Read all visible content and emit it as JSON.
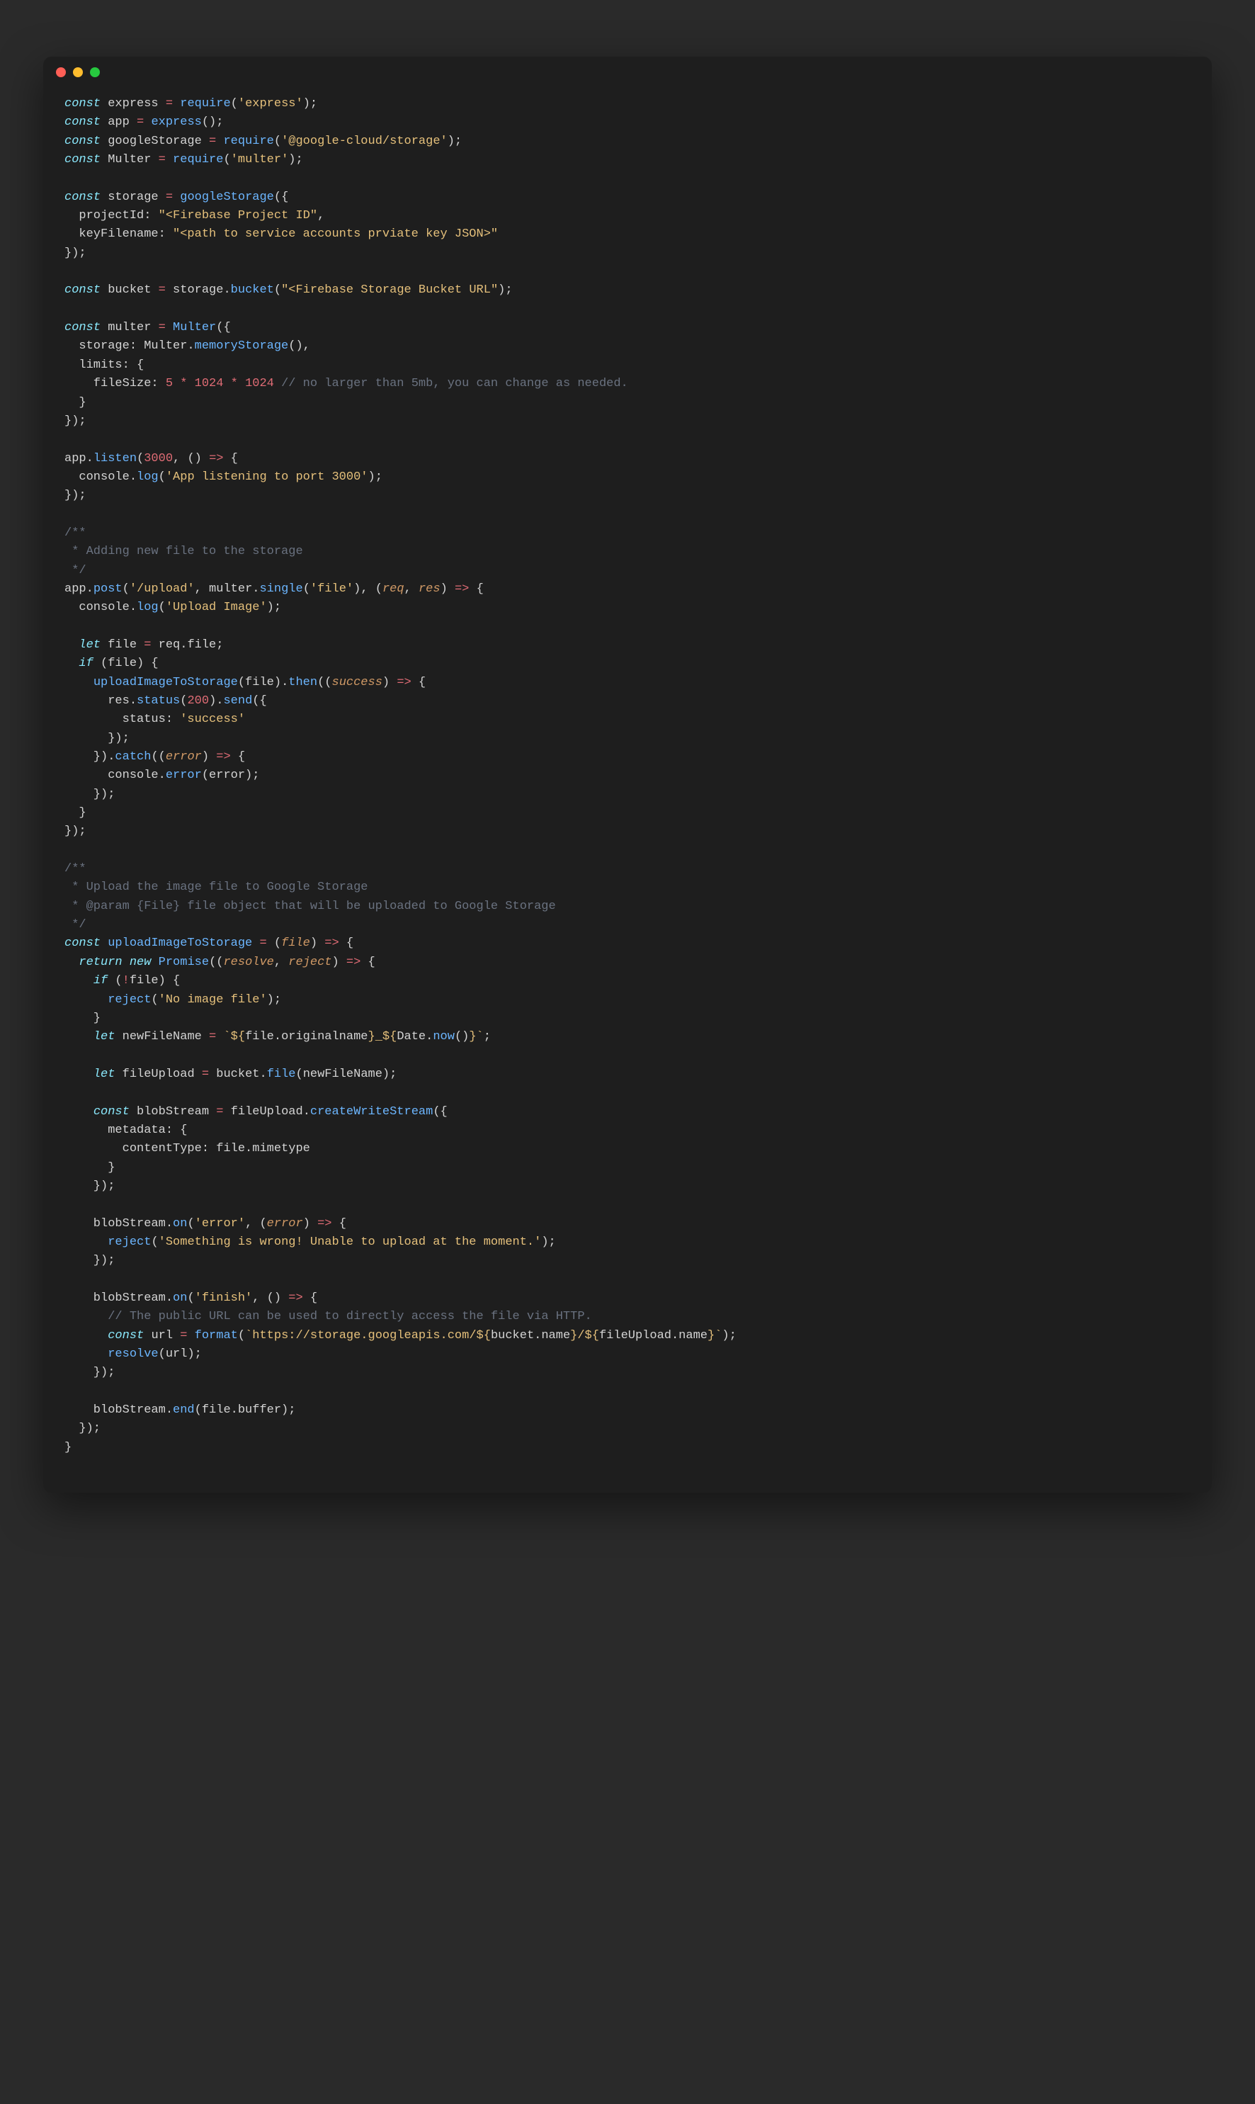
{
  "window": {
    "dots": [
      "red",
      "yellow",
      "green"
    ]
  },
  "code": {
    "lines": [
      [
        {
          "t": "const ",
          "c": "kw"
        },
        {
          "t": "express",
          "c": "def"
        },
        {
          "t": " = ",
          "c": "op"
        },
        {
          "t": "require",
          "c": "call"
        },
        {
          "t": "(",
          "c": "punc"
        },
        {
          "t": "'express'",
          "c": "str"
        },
        {
          "t": ");",
          "c": "punc"
        }
      ],
      [
        {
          "t": "const ",
          "c": "kw"
        },
        {
          "t": "app",
          "c": "def"
        },
        {
          "t": " = ",
          "c": "op"
        },
        {
          "t": "express",
          "c": "call"
        },
        {
          "t": "();",
          "c": "punc"
        }
      ],
      [
        {
          "t": "const ",
          "c": "kw"
        },
        {
          "t": "googleStorage",
          "c": "def"
        },
        {
          "t": " = ",
          "c": "op"
        },
        {
          "t": "require",
          "c": "call"
        },
        {
          "t": "(",
          "c": "punc"
        },
        {
          "t": "'@google-cloud/storage'",
          "c": "str"
        },
        {
          "t": ");",
          "c": "punc"
        }
      ],
      [
        {
          "t": "const ",
          "c": "kw"
        },
        {
          "t": "Multer",
          "c": "def"
        },
        {
          "t": " = ",
          "c": "op"
        },
        {
          "t": "require",
          "c": "call"
        },
        {
          "t": "(",
          "c": "punc"
        },
        {
          "t": "'multer'",
          "c": "str"
        },
        {
          "t": ");",
          "c": "punc"
        }
      ],
      [],
      [
        {
          "t": "const ",
          "c": "kw"
        },
        {
          "t": "storage",
          "c": "def"
        },
        {
          "t": " = ",
          "c": "op"
        },
        {
          "t": "googleStorage",
          "c": "call"
        },
        {
          "t": "({",
          "c": "punc"
        }
      ],
      [
        {
          "t": "  projectId: ",
          "c": "prop"
        },
        {
          "t": "\"<Firebase Project ID\"",
          "c": "str"
        },
        {
          "t": ",",
          "c": "punc"
        }
      ],
      [
        {
          "t": "  keyFilename: ",
          "c": "prop"
        },
        {
          "t": "\"<path to service accounts prviate key JSON>\"",
          "c": "str"
        }
      ],
      [
        {
          "t": "});",
          "c": "punc"
        }
      ],
      [],
      [
        {
          "t": "const ",
          "c": "kw"
        },
        {
          "t": "bucket",
          "c": "def"
        },
        {
          "t": " = ",
          "c": "op"
        },
        {
          "t": "storage.",
          "c": "prop"
        },
        {
          "t": "bucket",
          "c": "call"
        },
        {
          "t": "(",
          "c": "punc"
        },
        {
          "t": "\"<Firebase Storage Bucket URL\"",
          "c": "str"
        },
        {
          "t": ");",
          "c": "punc"
        }
      ],
      [],
      [
        {
          "t": "const ",
          "c": "kw"
        },
        {
          "t": "multer",
          "c": "def"
        },
        {
          "t": " = ",
          "c": "op"
        },
        {
          "t": "Multer",
          "c": "call"
        },
        {
          "t": "({",
          "c": "punc"
        }
      ],
      [
        {
          "t": "  storage: Multer.",
          "c": "prop"
        },
        {
          "t": "memoryStorage",
          "c": "call"
        },
        {
          "t": "(),",
          "c": "punc"
        }
      ],
      [
        {
          "t": "  limits: {",
          "c": "prop"
        }
      ],
      [
        {
          "t": "    fileSize: ",
          "c": "prop"
        },
        {
          "t": "5",
          "c": "num"
        },
        {
          "t": " * ",
          "c": "op"
        },
        {
          "t": "1024",
          "c": "num"
        },
        {
          "t": " * ",
          "c": "op"
        },
        {
          "t": "1024",
          "c": "num"
        },
        {
          "t": " ",
          "c": "punc"
        },
        {
          "t": "// no larger than 5mb, you can change as needed.",
          "c": "cmt"
        }
      ],
      [
        {
          "t": "  }",
          "c": "punc"
        }
      ],
      [
        {
          "t": "});",
          "c": "punc"
        }
      ],
      [],
      [
        {
          "t": "app.",
          "c": "prop"
        },
        {
          "t": "listen",
          "c": "call"
        },
        {
          "t": "(",
          "c": "punc"
        },
        {
          "t": "3000",
          "c": "num"
        },
        {
          "t": ", () ",
          "c": "punc"
        },
        {
          "t": "=>",
          "c": "op"
        },
        {
          "t": " {",
          "c": "punc"
        }
      ],
      [
        {
          "t": "  console.",
          "c": "prop"
        },
        {
          "t": "log",
          "c": "call"
        },
        {
          "t": "(",
          "c": "punc"
        },
        {
          "t": "'App listening to port 3000'",
          "c": "str"
        },
        {
          "t": ");",
          "c": "punc"
        }
      ],
      [
        {
          "t": "});",
          "c": "punc"
        }
      ],
      [],
      [
        {
          "t": "/**",
          "c": "cmt"
        }
      ],
      [
        {
          "t": " * Adding new file to the storage",
          "c": "cmt"
        }
      ],
      [
        {
          "t": " */",
          "c": "cmt"
        }
      ],
      [
        {
          "t": "app.",
          "c": "prop"
        },
        {
          "t": "post",
          "c": "call"
        },
        {
          "t": "(",
          "c": "punc"
        },
        {
          "t": "'/upload'",
          "c": "str"
        },
        {
          "t": ", multer.",
          "c": "prop"
        },
        {
          "t": "single",
          "c": "call"
        },
        {
          "t": "(",
          "c": "punc"
        },
        {
          "t": "'file'",
          "c": "str"
        },
        {
          "t": "), (",
          "c": "punc"
        },
        {
          "t": "req",
          "c": "param"
        },
        {
          "t": ", ",
          "c": "punc"
        },
        {
          "t": "res",
          "c": "param"
        },
        {
          "t": ") ",
          "c": "punc"
        },
        {
          "t": "=>",
          "c": "op"
        },
        {
          "t": " {",
          "c": "punc"
        }
      ],
      [
        {
          "t": "  console.",
          "c": "prop"
        },
        {
          "t": "log",
          "c": "call"
        },
        {
          "t": "(",
          "c": "punc"
        },
        {
          "t": "'Upload Image'",
          "c": "str"
        },
        {
          "t": ");",
          "c": "punc"
        }
      ],
      [],
      [
        {
          "t": "  ",
          "c": "punc"
        },
        {
          "t": "let ",
          "c": "kw"
        },
        {
          "t": "file",
          "c": "def"
        },
        {
          "t": " = ",
          "c": "op"
        },
        {
          "t": "req.file;",
          "c": "prop"
        }
      ],
      [
        {
          "t": "  ",
          "c": "punc"
        },
        {
          "t": "if ",
          "c": "kw"
        },
        {
          "t": "(file) {",
          "c": "punc"
        }
      ],
      [
        {
          "t": "    ",
          "c": "punc"
        },
        {
          "t": "uploadImageToStorage",
          "c": "call"
        },
        {
          "t": "(file).",
          "c": "punc"
        },
        {
          "t": "then",
          "c": "call"
        },
        {
          "t": "((",
          "c": "punc"
        },
        {
          "t": "success",
          "c": "param"
        },
        {
          "t": ") ",
          "c": "punc"
        },
        {
          "t": "=>",
          "c": "op"
        },
        {
          "t": " {",
          "c": "punc"
        }
      ],
      [
        {
          "t": "      res.",
          "c": "prop"
        },
        {
          "t": "status",
          "c": "call"
        },
        {
          "t": "(",
          "c": "punc"
        },
        {
          "t": "200",
          "c": "num"
        },
        {
          "t": ").",
          "c": "punc"
        },
        {
          "t": "send",
          "c": "call"
        },
        {
          "t": "({",
          "c": "punc"
        }
      ],
      [
        {
          "t": "        status: ",
          "c": "prop"
        },
        {
          "t": "'success'",
          "c": "str"
        }
      ],
      [
        {
          "t": "      });",
          "c": "punc"
        }
      ],
      [
        {
          "t": "    }).",
          "c": "punc"
        },
        {
          "t": "catch",
          "c": "call"
        },
        {
          "t": "((",
          "c": "punc"
        },
        {
          "t": "error",
          "c": "param"
        },
        {
          "t": ") ",
          "c": "punc"
        },
        {
          "t": "=>",
          "c": "op"
        },
        {
          "t": " {",
          "c": "punc"
        }
      ],
      [
        {
          "t": "      console.",
          "c": "prop"
        },
        {
          "t": "error",
          "c": "call"
        },
        {
          "t": "(error);",
          "c": "punc"
        }
      ],
      [
        {
          "t": "    });",
          "c": "punc"
        }
      ],
      [
        {
          "t": "  }",
          "c": "punc"
        }
      ],
      [
        {
          "t": "});",
          "c": "punc"
        }
      ],
      [],
      [
        {
          "t": "/**",
          "c": "cmt"
        }
      ],
      [
        {
          "t": " * Upload the image file to Google Storage",
          "c": "cmt"
        }
      ],
      [
        {
          "t": " * @param {File} file object that will be uploaded to Google Storage",
          "c": "cmt"
        }
      ],
      [
        {
          "t": " */",
          "c": "cmt"
        }
      ],
      [
        {
          "t": "const ",
          "c": "kw"
        },
        {
          "t": "uploadImageToStorage",
          "c": "fn"
        },
        {
          "t": " = ",
          "c": "op"
        },
        {
          "t": "(",
          "c": "punc"
        },
        {
          "t": "file",
          "c": "param"
        },
        {
          "t": ") ",
          "c": "punc"
        },
        {
          "t": "=>",
          "c": "op"
        },
        {
          "t": " {",
          "c": "punc"
        }
      ],
      [
        {
          "t": "  ",
          "c": "punc"
        },
        {
          "t": "return ",
          "c": "kw"
        },
        {
          "t": "new ",
          "c": "new"
        },
        {
          "t": "Promise",
          "c": "call"
        },
        {
          "t": "((",
          "c": "punc"
        },
        {
          "t": "resolve",
          "c": "param"
        },
        {
          "t": ", ",
          "c": "punc"
        },
        {
          "t": "reject",
          "c": "param"
        },
        {
          "t": ") ",
          "c": "punc"
        },
        {
          "t": "=>",
          "c": "op"
        },
        {
          "t": " {",
          "c": "punc"
        }
      ],
      [
        {
          "t": "    ",
          "c": "punc"
        },
        {
          "t": "if ",
          "c": "kw"
        },
        {
          "t": "(",
          "c": "punc"
        },
        {
          "t": "!",
          "c": "op"
        },
        {
          "t": "file) {",
          "c": "punc"
        }
      ],
      [
        {
          "t": "      ",
          "c": "punc"
        },
        {
          "t": "reject",
          "c": "call"
        },
        {
          "t": "(",
          "c": "punc"
        },
        {
          "t": "'No image file'",
          "c": "str"
        },
        {
          "t": ");",
          "c": "punc"
        }
      ],
      [
        {
          "t": "    }",
          "c": "punc"
        }
      ],
      [
        {
          "t": "    ",
          "c": "punc"
        },
        {
          "t": "let ",
          "c": "kw"
        },
        {
          "t": "newFileName",
          "c": "def"
        },
        {
          "t": " = ",
          "c": "op"
        },
        {
          "t": "`${",
          "c": "tmpl"
        },
        {
          "t": "file.originalname",
          "c": "prop"
        },
        {
          "t": "}_${",
          "c": "tmpl"
        },
        {
          "t": "Date.",
          "c": "prop"
        },
        {
          "t": "now",
          "c": "call"
        },
        {
          "t": "()",
          "c": "punc"
        },
        {
          "t": "}`",
          "c": "tmpl"
        },
        {
          "t": ";",
          "c": "punc"
        }
      ],
      [],
      [
        {
          "t": "    ",
          "c": "punc"
        },
        {
          "t": "let ",
          "c": "kw"
        },
        {
          "t": "fileUpload",
          "c": "def"
        },
        {
          "t": " = ",
          "c": "op"
        },
        {
          "t": "bucket.",
          "c": "prop"
        },
        {
          "t": "file",
          "c": "call"
        },
        {
          "t": "(newFileName);",
          "c": "punc"
        }
      ],
      [],
      [
        {
          "t": "    ",
          "c": "punc"
        },
        {
          "t": "const ",
          "c": "kw"
        },
        {
          "t": "blobStream",
          "c": "def"
        },
        {
          "t": " = ",
          "c": "op"
        },
        {
          "t": "fileUpload.",
          "c": "prop"
        },
        {
          "t": "createWriteStream",
          "c": "call"
        },
        {
          "t": "({",
          "c": "punc"
        }
      ],
      [
        {
          "t": "      metadata: {",
          "c": "prop"
        }
      ],
      [
        {
          "t": "        contentType: file.mimetype",
          "c": "prop"
        }
      ],
      [
        {
          "t": "      }",
          "c": "punc"
        }
      ],
      [
        {
          "t": "    });",
          "c": "punc"
        }
      ],
      [],
      [
        {
          "t": "    blobStream.",
          "c": "prop"
        },
        {
          "t": "on",
          "c": "call"
        },
        {
          "t": "(",
          "c": "punc"
        },
        {
          "t": "'error'",
          "c": "str"
        },
        {
          "t": ", (",
          "c": "punc"
        },
        {
          "t": "error",
          "c": "param"
        },
        {
          "t": ") ",
          "c": "punc"
        },
        {
          "t": "=>",
          "c": "op"
        },
        {
          "t": " {",
          "c": "punc"
        }
      ],
      [
        {
          "t": "      ",
          "c": "punc"
        },
        {
          "t": "reject",
          "c": "call"
        },
        {
          "t": "(",
          "c": "punc"
        },
        {
          "t": "'Something is wrong! Unable to upload at the moment.'",
          "c": "str"
        },
        {
          "t": ");",
          "c": "punc"
        }
      ],
      [
        {
          "t": "    });",
          "c": "punc"
        }
      ],
      [],
      [
        {
          "t": "    blobStream.",
          "c": "prop"
        },
        {
          "t": "on",
          "c": "call"
        },
        {
          "t": "(",
          "c": "punc"
        },
        {
          "t": "'finish'",
          "c": "str"
        },
        {
          "t": ", () ",
          "c": "punc"
        },
        {
          "t": "=>",
          "c": "op"
        },
        {
          "t": " {",
          "c": "punc"
        }
      ],
      [
        {
          "t": "      ",
          "c": "punc"
        },
        {
          "t": "// The public URL can be used to directly access the file via HTTP.",
          "c": "cmt"
        }
      ],
      [
        {
          "t": "      ",
          "c": "punc"
        },
        {
          "t": "const ",
          "c": "kw"
        },
        {
          "t": "url",
          "c": "def"
        },
        {
          "t": " = ",
          "c": "op"
        },
        {
          "t": "format",
          "c": "call"
        },
        {
          "t": "(",
          "c": "punc"
        },
        {
          "t": "`https://storage.googleapis.com/${",
          "c": "tmpl"
        },
        {
          "t": "bucket.name",
          "c": "prop"
        },
        {
          "t": "}/${",
          "c": "tmpl"
        },
        {
          "t": "fileUpload.name",
          "c": "prop"
        },
        {
          "t": "}`",
          "c": "tmpl"
        },
        {
          "t": ");",
          "c": "punc"
        }
      ],
      [
        {
          "t": "      ",
          "c": "punc"
        },
        {
          "t": "resolve",
          "c": "call"
        },
        {
          "t": "(url);",
          "c": "punc"
        }
      ],
      [
        {
          "t": "    });",
          "c": "punc"
        }
      ],
      [],
      [
        {
          "t": "    blobStream.",
          "c": "prop"
        },
        {
          "t": "end",
          "c": "call"
        },
        {
          "t": "(file.buffer);",
          "c": "punc"
        }
      ],
      [
        {
          "t": "  });",
          "c": "punc"
        }
      ],
      [
        {
          "t": "}",
          "c": "punc"
        }
      ]
    ]
  }
}
